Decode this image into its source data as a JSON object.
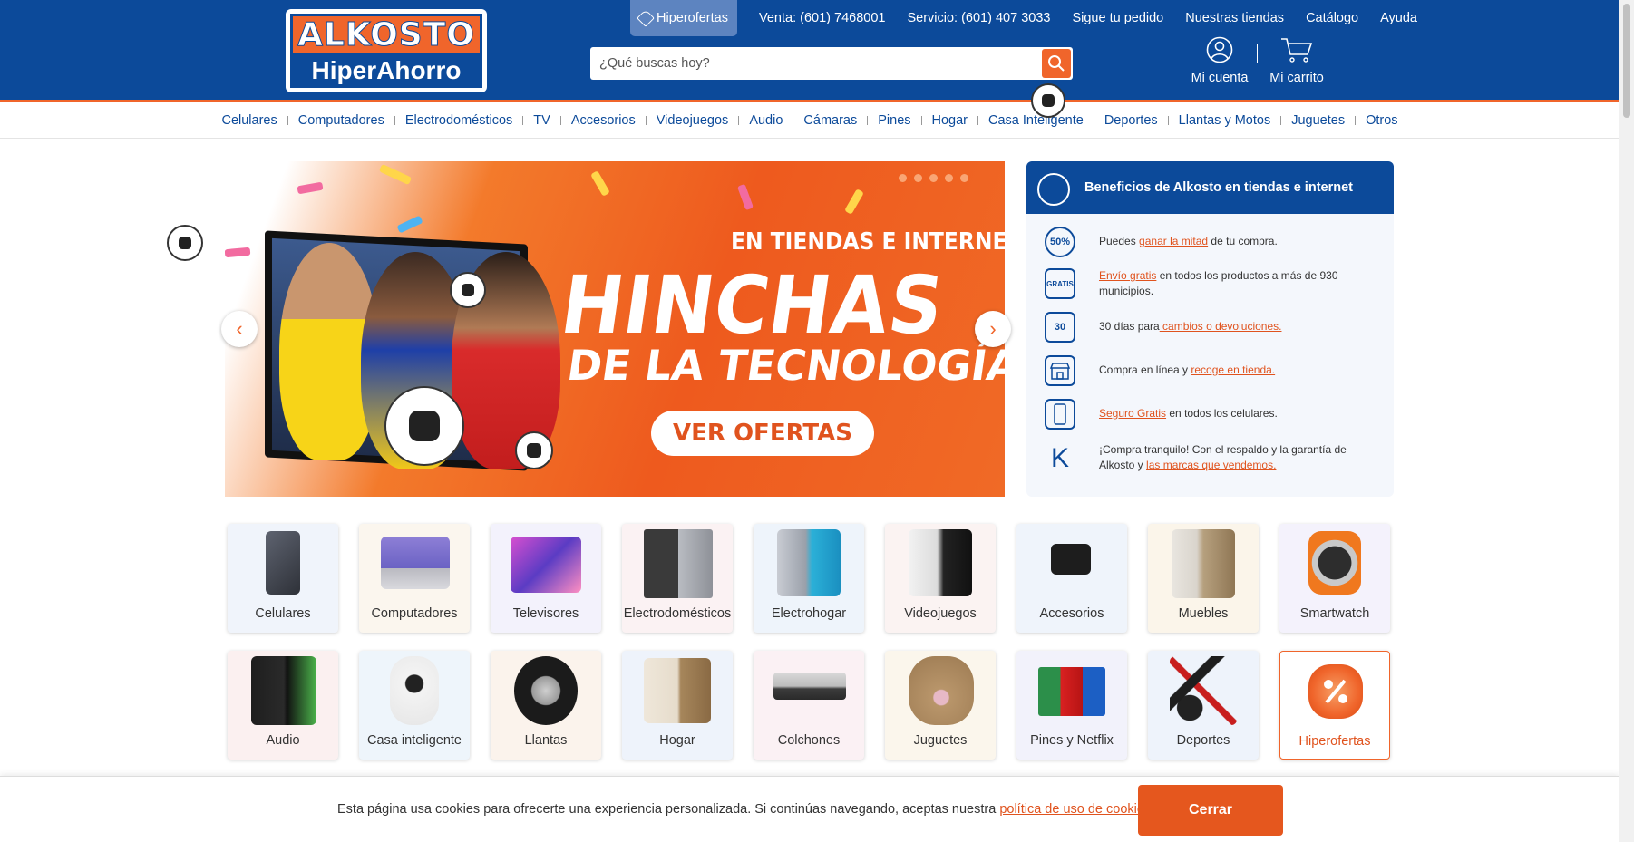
{
  "header": {
    "logo_top": "ALKOSTO",
    "logo_bottom": "HiperAhorro",
    "links": {
      "hiperofertas": "Hiperofertas",
      "venta": "Venta: (601) 7468001",
      "servicio": "Servicio: (601) 407 3033",
      "pedido": "Sigue tu pedido",
      "tiendas": "Nuestras tiendas",
      "catalogo": "Catálogo",
      "ayuda": "Ayuda"
    },
    "search_placeholder": "¿Qué buscas hoy?",
    "account": "Mi cuenta",
    "cart": "Mi carrito"
  },
  "nav": {
    "items": [
      "Celulares",
      "Computadores",
      "Electrodomésticos",
      "TV",
      "Accesorios",
      "Videojuegos",
      "Audio",
      "Cámaras",
      "Pines",
      "Hogar",
      "Casa Inteligente",
      "Deportes",
      "Llantas y Motos",
      "Juguetes",
      "Otros"
    ]
  },
  "banner": {
    "small": "EN TIENDAS E INTERNET",
    "big": "HINCHAS",
    "mid": "DE LA TECNOLOGÍA",
    "button": "VER OFERTAS",
    "prev": "‹",
    "next": "›"
  },
  "benefits": {
    "title": "Beneficios de Alkosto en tiendas e internet",
    "items": [
      {
        "icon": "50%",
        "pre": "Puedes ",
        "link": "ganar la mitad",
        "post": " de tu compra."
      },
      {
        "icon": "GRATIS",
        "pre": "",
        "link": "Envío gratis",
        "post": " en todos los productos a más de 930 municipios."
      },
      {
        "icon": "30",
        "pre": "30 días para",
        "link": " cambios o devoluciones.",
        "post": ""
      },
      {
        "icon": "store-icon",
        "pre": "Compra en línea y ",
        "link": "recoge en tienda.",
        "post": ""
      },
      {
        "icon": "phone-icon",
        "pre": "",
        "link": "Seguro Gratis",
        "post": " en todos los celulares."
      },
      {
        "icon": "K",
        "pre": "¡Compra tranquilo! Con el respaldo y la garantía de Alkosto y ",
        "link": "las marcas que vendemos.",
        "post": ""
      }
    ]
  },
  "categories": {
    "row1": [
      "Celulares",
      "Computadores",
      "Televisores",
      "Electrodomésticos",
      "Electrohogar",
      "Videojuegos",
      "Accesorios",
      "Muebles",
      "Smartwatch"
    ],
    "row2": [
      "Audio",
      "Casa inteligente",
      "Llantas",
      "Hogar",
      "Colchones",
      "Juguetes",
      "Pines y Netflix",
      "Deportes",
      "Hiperofertas"
    ]
  },
  "cookie": {
    "text": "Esta página usa cookies para ofrecerte una experiencia personalizada. Si continúas navegando, aceptas nuestra ",
    "link": "política de uso de cookies",
    "end": ".",
    "button": "Cerrar"
  },
  "colors": {
    "brand_blue": "#0c4a9a",
    "brand_orange": "#f0652b"
  }
}
